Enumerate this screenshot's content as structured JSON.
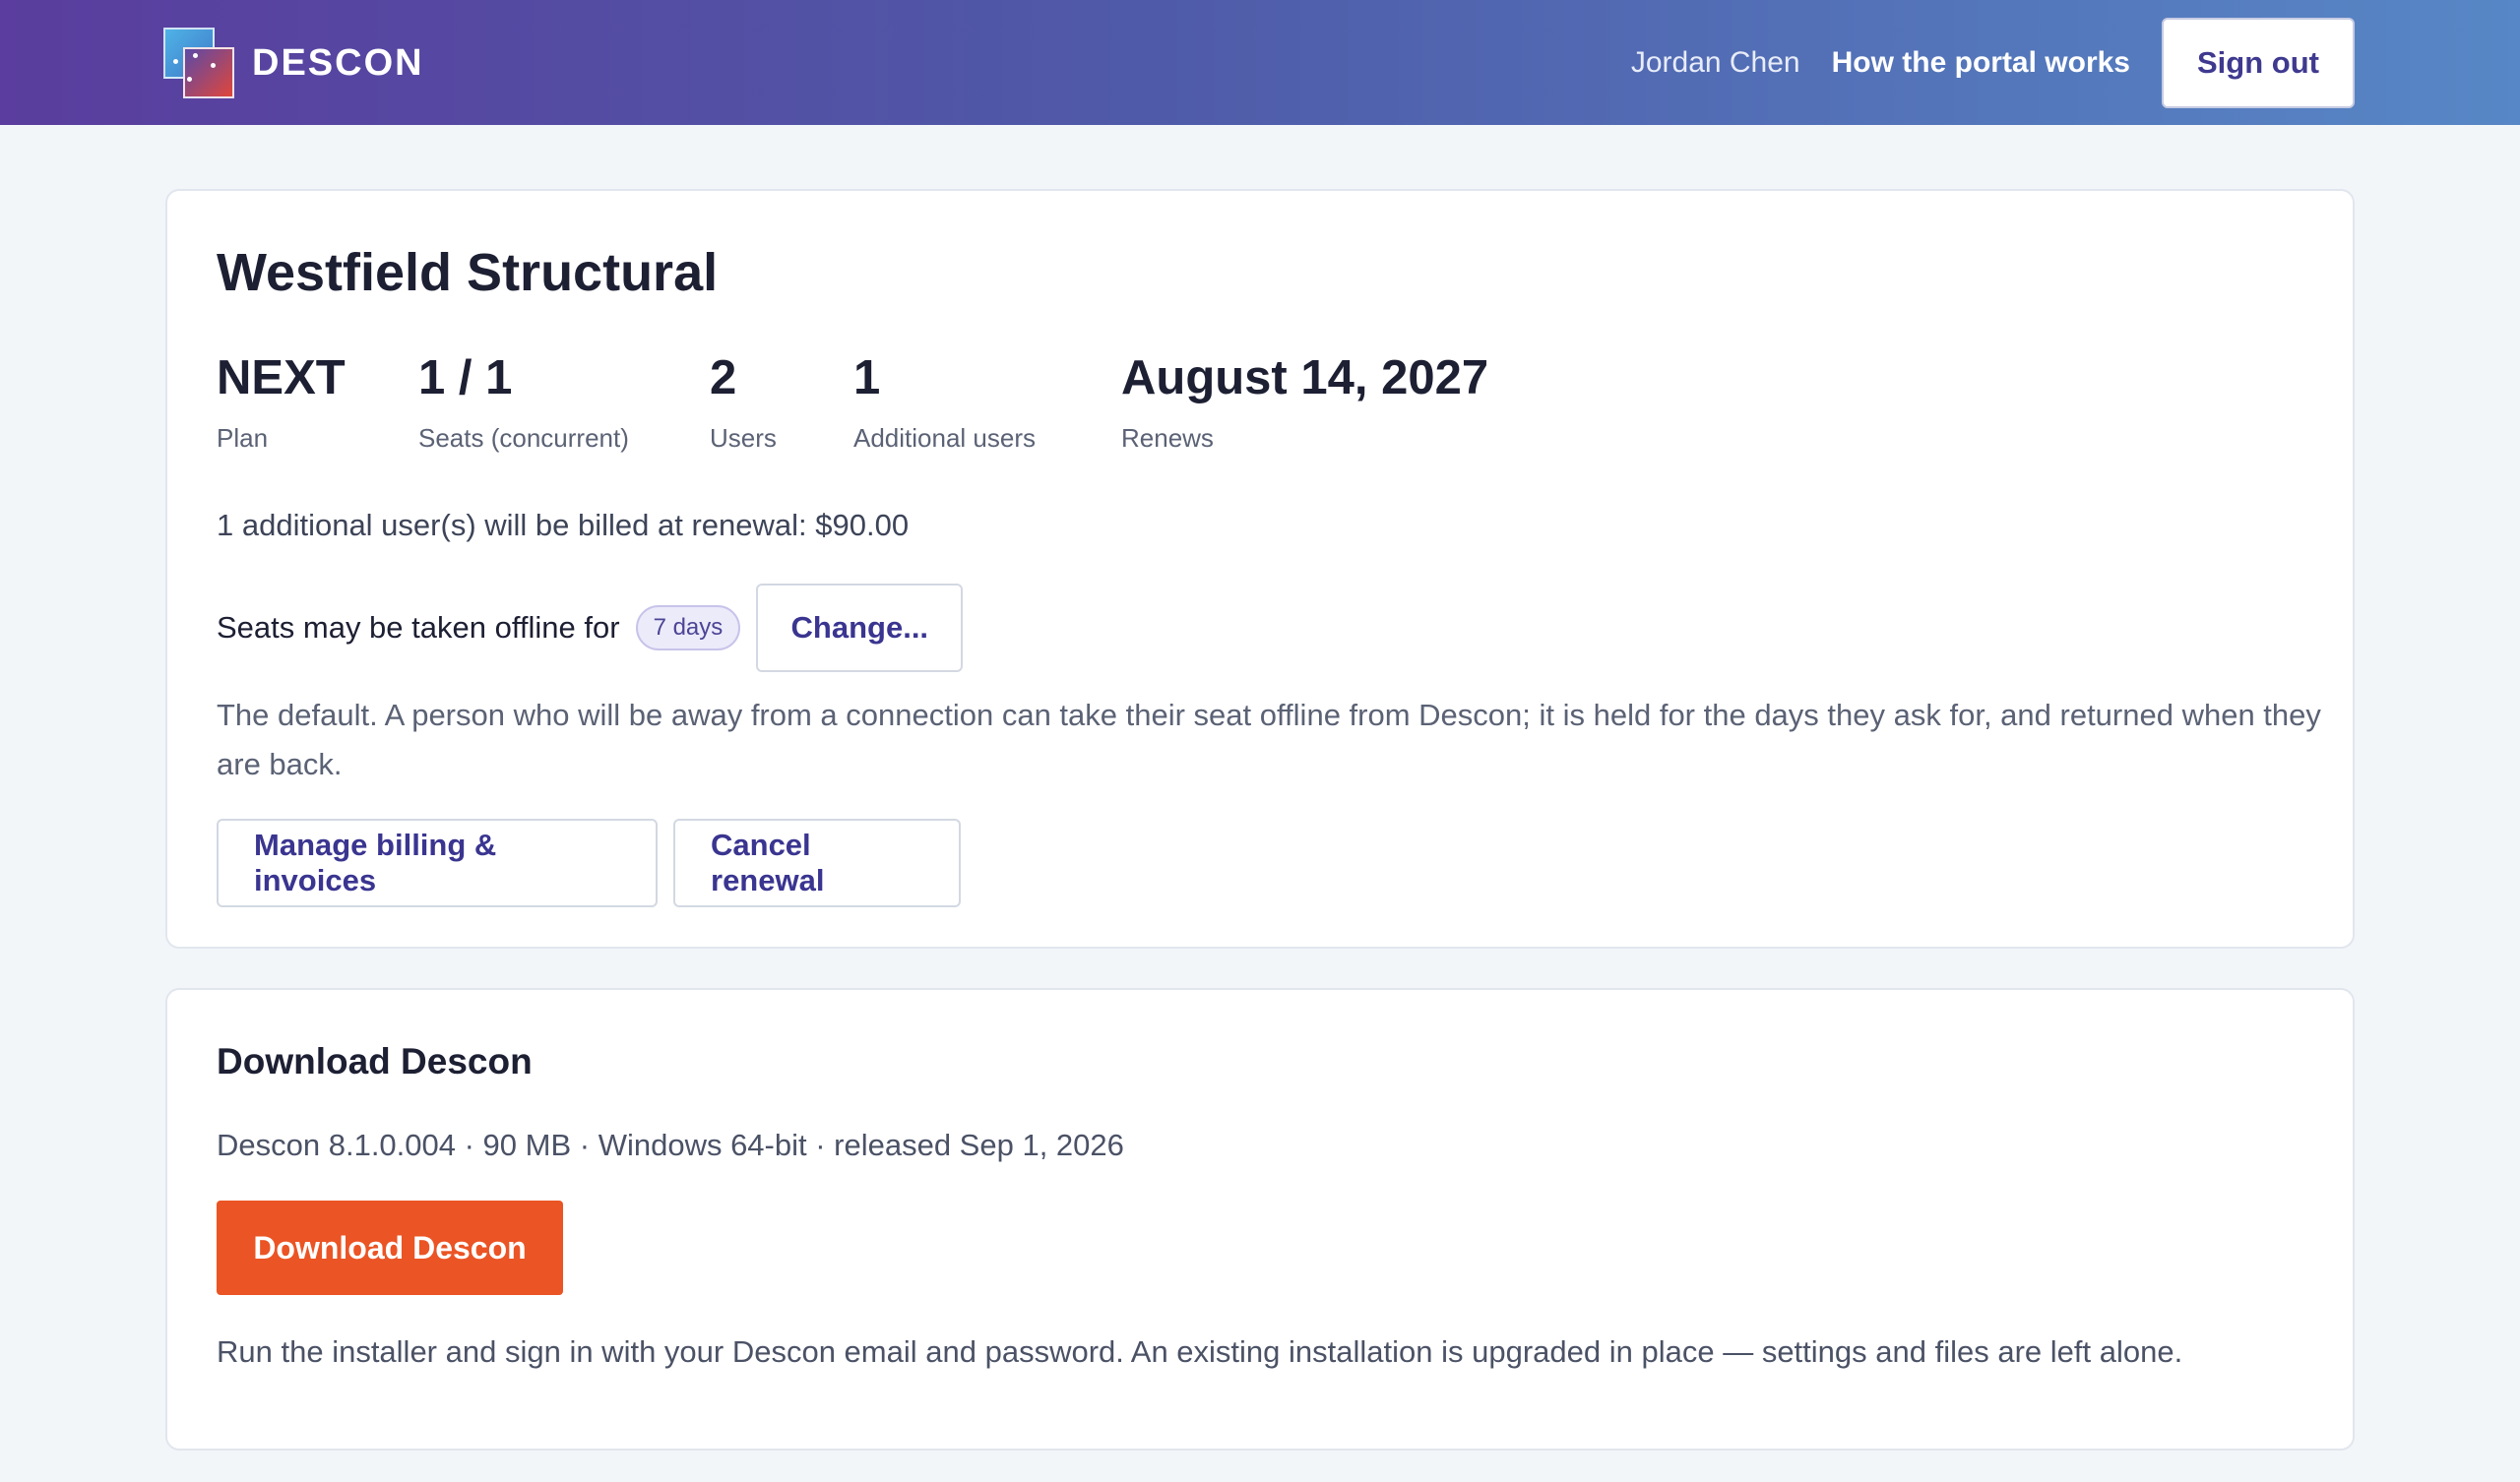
{
  "header": {
    "brand": "DESCON",
    "user_name": "Jordan Chen",
    "help_link": "How the portal works",
    "sign_out": "Sign out",
    "logo_icon": "descon-logo-icon"
  },
  "account": {
    "org_name": "Westfield Structural",
    "stats": [
      {
        "value": "NEXT",
        "label": "Plan"
      },
      {
        "value": "1 / 1",
        "label": "Seats (concurrent)"
      },
      {
        "value": "2",
        "label": "Users"
      },
      {
        "value": "1",
        "label": "Additional users"
      },
      {
        "value": "August 14, 2027",
        "label": "Renews"
      }
    ],
    "billing_note": "1 additional user(s) will be billed at renewal: $90.00",
    "offline_text": "Seats may be taken offline for",
    "offline_days": "7 days",
    "change_button": "Change...",
    "offline_description": "The default. A person who will be away from a connection can take their seat offline from Descon; it is held for the days they ask for, and returned when they are back.",
    "manage_billing_button": "Manage billing & invoices",
    "cancel_renewal_button": "Cancel renewal"
  },
  "download": {
    "title": "Download Descon",
    "meta": "Descon 8.1.0.004 · 90 MB · Windows 64-bit · released Sep 1, 2026",
    "button": "Download Descon",
    "note": "Run the installer and sign in with your Descon email and password. An existing installation is upgraded in place — settings and files are left alone."
  },
  "colors": {
    "header_gradient_start": "#5a3d9e",
    "header_gradient_end": "#5787c6",
    "accent_text": "#3a3590",
    "download_button": "#eb5424",
    "page_background": "#f3f6f9"
  }
}
